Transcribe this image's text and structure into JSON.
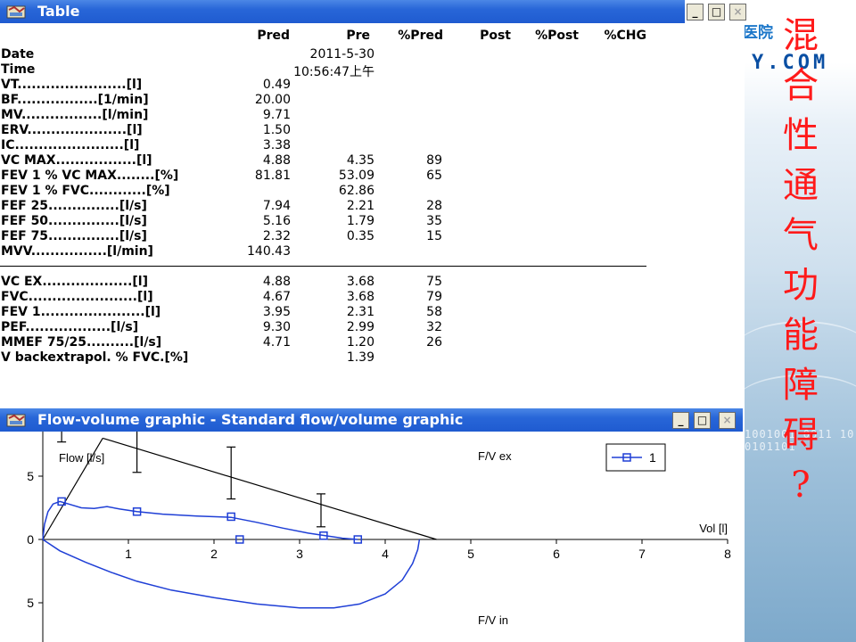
{
  "table_window": {
    "title": "Table",
    "columns": [
      "Pred",
      "Pre",
      "%Pred",
      "Post",
      "%Post",
      "%CHG"
    ],
    "rows": [
      {
        "label": "Date",
        "pred": "",
        "pre": "2011-5-30",
        "pct": ""
      },
      {
        "label": "Time",
        "pred": "",
        "pre": "10:56:47上午",
        "pct": ""
      },
      {
        "label": "VT.......................[l]",
        "pred": "0.49",
        "pre": "",
        "pct": ""
      },
      {
        "label": "BF.................[1/min]",
        "pred": "20.00",
        "pre": "",
        "pct": ""
      },
      {
        "label": "MV.................[l/min]",
        "pred": "9.71",
        "pre": "",
        "pct": ""
      },
      {
        "label": "ERV.....................[l]",
        "pred": "1.50",
        "pre": "",
        "pct": ""
      },
      {
        "label": "IC.......................[l]",
        "pred": "3.38",
        "pre": "",
        "pct": ""
      },
      {
        "label": "VC MAX.................[l]",
        "pred": "4.88",
        "pre": "4.35",
        "pct": "89"
      },
      {
        "label": "FEV 1 % VC MAX........[%]",
        "pred": "81.81",
        "pre": "53.09",
        "pct": "65"
      },
      {
        "label": "FEV 1 % FVC............[%]",
        "pred": "",
        "pre": "62.86",
        "pct": ""
      },
      {
        "label": "FEF 25...............[l/s]",
        "pred": "7.94",
        "pre": "2.21",
        "pct": "28"
      },
      {
        "label": "FEF 50...............[l/s]",
        "pred": "5.16",
        "pre": "1.79",
        "pct": "35"
      },
      {
        "label": "FEF 75...............[l/s]",
        "pred": "2.32",
        "pre": "0.35",
        "pct": "15"
      },
      {
        "label": "MVV................[l/min]",
        "pred": "140.43",
        "pre": "",
        "pct": ""
      },
      {
        "label": "VC EX...................[l]",
        "pred": "4.88",
        "pre": "3.68",
        "pct": "75"
      },
      {
        "label": "FVC.......................[l]",
        "pred": "4.67",
        "pre": "3.68",
        "pct": "79"
      },
      {
        "label": "FEV 1......................[l]",
        "pred": "3.95",
        "pre": "2.31",
        "pct": "58"
      },
      {
        "label": "PEF..................[l/s]",
        "pred": "9.30",
        "pre": "2.99",
        "pct": "32"
      },
      {
        "label": "MMEF 75/25..........[l/s]",
        "pred": "4.71",
        "pre": "1.20",
        "pct": "26"
      },
      {
        "label": "V backextrapol. % FVC.[%]",
        "pred": "",
        "pre": "1.39",
        "pct": ""
      }
    ],
    "buttons": {
      "minimize": "_",
      "maximize": "□",
      "close": "×"
    }
  },
  "graph_window": {
    "title": "Flow-volume graphic - Standard flow/volume graphic",
    "buttons": {
      "minimize": "_",
      "maximize": "□",
      "close": "×"
    }
  },
  "chart_data": {
    "type": "line",
    "ylabel": "Flow [l/s]",
    "xlabel": "Vol [l]",
    "annotations": [
      "F/V ex",
      "F/V in"
    ],
    "x_ticks": [
      "0",
      "1",
      "2",
      "3",
      "4",
      "5",
      "6",
      "7",
      "8"
    ],
    "y_ticks": [
      "5",
      "0",
      "5"
    ],
    "xlim": [
      0,
      8
    ],
    "ylim": [
      -6.5,
      8
    ],
    "legend": {
      "position": "top-right",
      "entries": [
        "1"
      ]
    },
    "colors": {
      "measured": "#1f3fd6",
      "predicted": "#000000"
    },
    "series": [
      {
        "name": "1",
        "kind": "expiratory",
        "x": [
          0,
          0.02,
          0.06,
          0.12,
          0.2,
          0.3,
          0.45,
          0.6,
          0.75,
          0.9,
          1.1,
          1.4,
          1.8,
          2.2,
          2.5,
          2.8,
          3.1,
          3.3,
          3.5,
          3.68
        ],
        "y": [
          0,
          1.2,
          2.2,
          2.8,
          3.0,
          2.8,
          2.5,
          2.45,
          2.6,
          2.4,
          2.2,
          2.0,
          1.85,
          1.75,
          1.35,
          0.9,
          0.5,
          0.3,
          0.1,
          0
        ]
      },
      {
        "name": "1",
        "kind": "inspiratory",
        "x": [
          0,
          0.2,
          0.5,
          0.8,
          1.1,
          1.5,
          2.0,
          2.5,
          3.0,
          3.4,
          3.7,
          4.0,
          4.2,
          4.32,
          4.38,
          4.4
        ],
        "y": [
          0,
          -0.9,
          -1.8,
          -2.6,
          -3.3,
          -4.0,
          -4.6,
          -5.1,
          -5.4,
          -5.4,
          -5.1,
          -4.3,
          -3.2,
          -1.9,
          -0.8,
          0
        ]
      }
    ],
    "markers": [
      {
        "x": 0.22,
        "y": 3.0
      },
      {
        "x": 1.1,
        "y": 2.2
      },
      {
        "x": 2.2,
        "y": 1.8
      },
      {
        "x": 2.3,
        "y": 0
      },
      {
        "x": 3.28,
        "y": 0.3
      },
      {
        "x": 3.68,
        "y": 0
      }
    ],
    "predicted": {
      "lines": [
        {
          "x": [
            0,
            0.7
          ],
          "y": [
            0,
            8
          ]
        },
        {
          "x": [
            0.7,
            4.6
          ],
          "y": [
            8,
            0
          ]
        }
      ],
      "error_bars": [
        {
          "x": 1.1,
          "y": 7.94,
          "low": 5.3,
          "high": 10.5
        },
        {
          "x": 2.2,
          "y": 5.16,
          "low": 3.2,
          "high": 7.3
        },
        {
          "x": 3.25,
          "y": 2.32,
          "low": 1.0,
          "high": 3.6
        },
        {
          "x": 0.22,
          "y": 8.6,
          "low": 7.7,
          "high": 9.4
        }
      ]
    }
  },
  "side_panel": {
    "brand_top": "医院",
    "brand_url": "Y.COM",
    "caption": [
      "混",
      "合",
      "性",
      "通",
      "气",
      "功",
      "能",
      "障",
      "碍",
      "?"
    ],
    "digits": "1001001 0011 10 0101101"
  }
}
